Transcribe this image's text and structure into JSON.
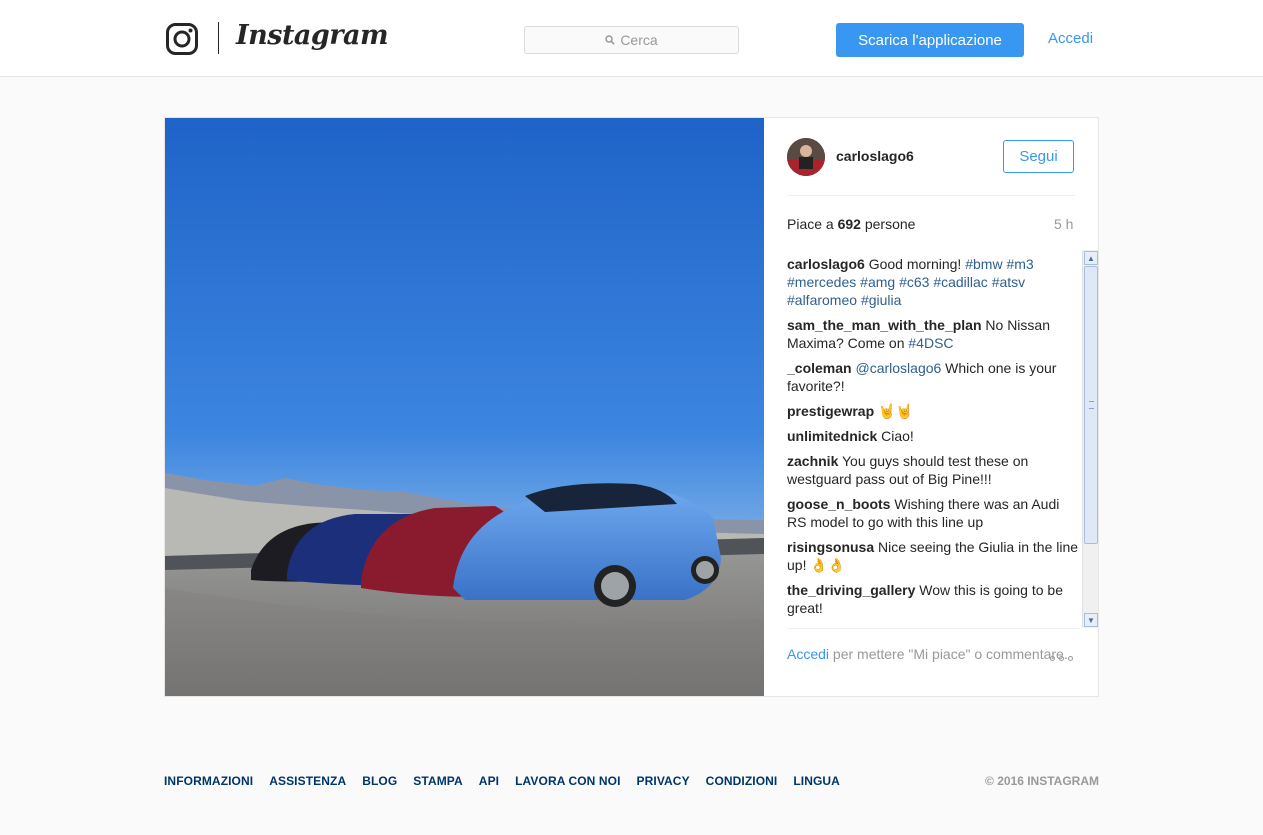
{
  "header": {
    "wordmark": "Instagram",
    "search_placeholder": "Cerca",
    "download_button": "Scarica l'applicazione",
    "login_link": "Accedi"
  },
  "post": {
    "author": "carloslago6",
    "follow_button": "Segui",
    "likes_prefix": "Piace a ",
    "likes_count": "692",
    "likes_suffix": " persone",
    "time_ago": "5 h",
    "comments": [
      {
        "user": "carloslago6",
        "parts": [
          {
            "t": " Good morning! "
          },
          {
            "t": "#bmw",
            "tag": true
          },
          {
            "t": " "
          },
          {
            "t": "#m3",
            "tag": true
          },
          {
            "t": " "
          },
          {
            "t": "#mercedes",
            "tag": true
          },
          {
            "t": " "
          },
          {
            "t": "#amg",
            "tag": true
          },
          {
            "t": " "
          },
          {
            "t": "#c63",
            "tag": true
          },
          {
            "t": " "
          },
          {
            "t": "#cadillac",
            "tag": true
          },
          {
            "t": " "
          },
          {
            "t": "#atsv",
            "tag": true
          },
          {
            "t": " "
          },
          {
            "t": "#alfaromeo",
            "tag": true
          },
          {
            "t": " "
          },
          {
            "t": "#giulia",
            "tag": true
          }
        ]
      },
      {
        "user": "sam_the_man_with_the_plan",
        "parts": [
          {
            "t": " No Nissan Maxima? Come on "
          },
          {
            "t": "#4DSC",
            "tag": true
          }
        ]
      },
      {
        "user": "_coleman",
        "parts": [
          {
            "t": " "
          },
          {
            "t": "@carloslago6",
            "tag": true
          },
          {
            "t": " Which one is your favorite?!"
          }
        ]
      },
      {
        "user": "prestigewrap",
        "parts": [
          {
            "t": " 🤘🤘"
          }
        ]
      },
      {
        "user": "unlimitednick",
        "parts": [
          {
            "t": " Ciao!"
          }
        ]
      },
      {
        "user": "zachnik",
        "parts": [
          {
            "t": " You guys should test these on westguard pass out of Big Pine!!!"
          }
        ]
      },
      {
        "user": "goose_n_boots",
        "parts": [
          {
            "t": " Wishing there was an Audi RS model to go with this line up"
          }
        ]
      },
      {
        "user": "risingsonusa",
        "parts": [
          {
            "t": " Nice seeing the Giulia in the line up! 👌👌"
          }
        ]
      },
      {
        "user": "the_driving_gallery",
        "parts": [
          {
            "t": " Wow this is going to be great!"
          }
        ]
      }
    ],
    "comment_login_link": "Accedi",
    "comment_prompt": " per mettere \"Mi piace\" o commentare."
  },
  "footer": {
    "links": [
      "INFORMAZIONI",
      "ASSISTENZA",
      "BLOG",
      "STAMPA",
      "API",
      "LAVORA CON NOI",
      "PRIVACY",
      "CONDIZIONI",
      "LINGUA"
    ],
    "copyright": "© 2016 INSTAGRAM"
  },
  "icons": {
    "logo": "instagram-camera-icon",
    "search": "search-icon",
    "more": "more-options-icon"
  },
  "colors": {
    "accent": "#3897f0",
    "tag": "#2f5f8f",
    "footer_link": "#003569"
  }
}
